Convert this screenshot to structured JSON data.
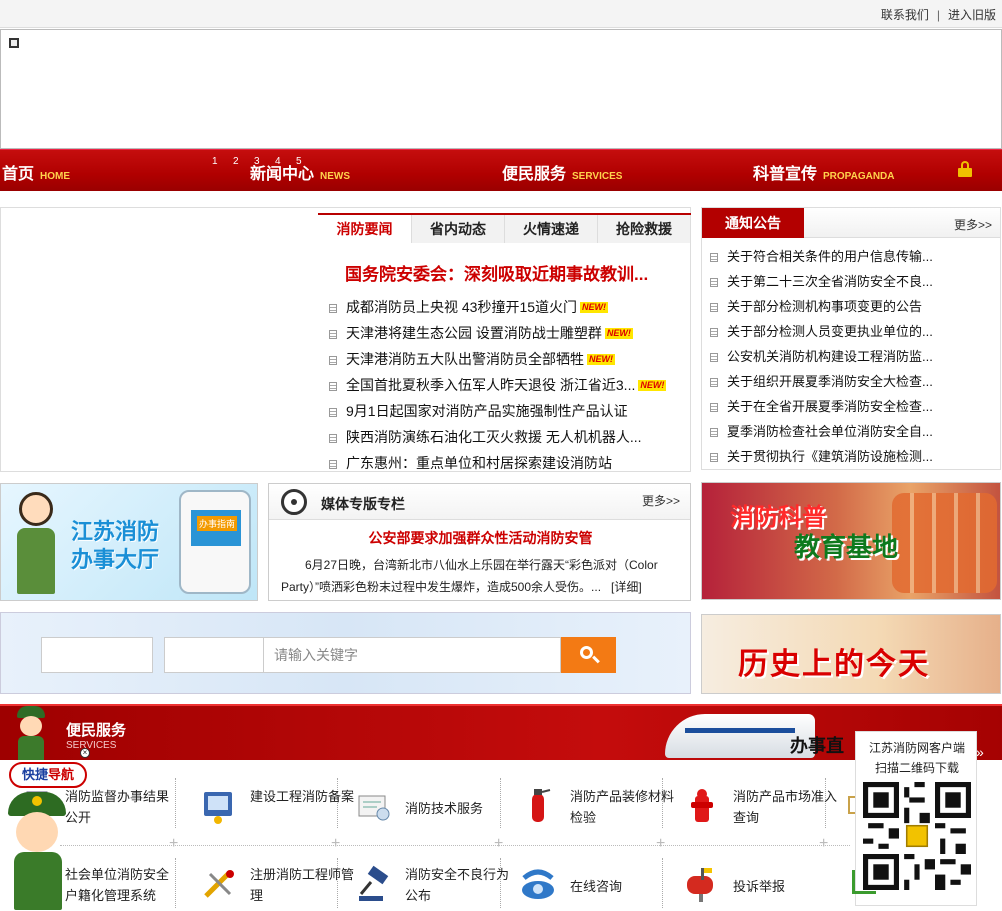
{
  "topbar": {
    "contact": "联系我们",
    "separator": "|",
    "old_version": "进入旧版"
  },
  "nav": {
    "items": [
      {
        "label": "首页",
        "en": "HOME"
      },
      {
        "label": "新闻中心",
        "en": "NEWS"
      },
      {
        "label": "便民服务",
        "en": "SERVICES"
      },
      {
        "label": "科普宣传",
        "en": "PROPAGANDA"
      }
    ],
    "slide_numbers": [
      "1",
      "2",
      "3",
      "4",
      "5"
    ]
  },
  "news": {
    "tabs": [
      "消防要闻",
      "省内动态",
      "火情速递",
      "抢险救援"
    ],
    "headline": "国务院安委会：深刻吸取近期事故教训...",
    "new_tag": "NEW!",
    "items": [
      {
        "text": "成都消防员上央视 43秒撞开15道火门",
        "is_new": true
      },
      {
        "text": "天津港将建生态公园 设置消防战士雕塑群",
        "is_new": true
      },
      {
        "text": "天津港消防五大队出警消防员全部牺牲",
        "is_new": true
      },
      {
        "text": "全国首批夏秋季入伍军人昨天退役 浙江省近3...",
        "is_new": true
      },
      {
        "text": "9月1日起国家对消防产品实施强制性产品认证",
        "is_new": false
      },
      {
        "text": "陕西消防演练石油化工灭火救援 无人机机器人...",
        "is_new": false
      },
      {
        "text": "广东惠州：重点单位和村居探索建设消防站",
        "is_new": false
      }
    ]
  },
  "notice": {
    "title": "通知公告",
    "more": "更多>>",
    "items": [
      "关于符合相关条件的用户信息传输...",
      "关于第二十三次全省消防安全不良...",
      "关于部分检测机构事项变更的公告",
      "关于部分检测人员变更执业单位的...",
      "公安机关消防机构建设工程消防监...",
      "关于组织开展夏季消防安全大检查...",
      "关于在全省开展夏季消防安全检查...",
      "夏季消防检查社会单位消防安全自...",
      "关于贯彻执行《建筑消防设施检测..."
    ]
  },
  "hall": {
    "title_line1": "江苏消防",
    "title_line2": "办事大厅",
    "kiosk_label": "办事指南"
  },
  "media": {
    "title": "媒体专版专栏",
    "more": "更多>>",
    "article_title": "公安部要求加强群众性活动消防安管",
    "article_text": "6月27日晚，台湾新北市八仙水上乐园在举行露天“彩色派对（Color Party）”喷洒彩色粉末过程中发生爆炸，造成500余人受伤。...",
    "detail_link": "[详细]"
  },
  "ads": {
    "science_line1": "消防科普",
    "science_line2": "教育基地",
    "history": "历史上的今天"
  },
  "search": {
    "placeholder": "请输入关键字"
  },
  "services": {
    "title": "便民服务",
    "en": "SERVICES",
    "banner_text": "办事直",
    "arrow": "»",
    "row1": [
      {
        "label": "消防监督办事结果公开",
        "icon": "document-icon"
      },
      {
        "label": "建设工程消防备案",
        "icon": "filing-icon"
      },
      {
        "label": "消防技术服务",
        "icon": "technical-service-icon"
      },
      {
        "label": "消防产品装修材料检验",
        "icon": "extinguisher-icon"
      },
      {
        "label": "消防产品市场准入查询",
        "icon": "hydrant-icon"
      }
    ],
    "row2": [
      {
        "label": "社会单位消防安全户籍化管理系统",
        "icon": "registry-icon"
      },
      {
        "label": "注册消防工程师管理",
        "icon": "engineer-tools-icon"
      },
      {
        "label": "消防安全不良行为公布",
        "icon": "gavel-icon"
      },
      {
        "label": "在线咨询",
        "icon": "phone-icon"
      },
      {
        "label": "投诉举报",
        "icon": "mailbox-icon"
      }
    ]
  },
  "quick_nav": {
    "part1": "快捷",
    "part2": "导航",
    "close": "×"
  },
  "qr": {
    "line1": "江苏消防网客户端",
    "line2": "扫描二维码下载"
  },
  "colors": {
    "brand_red": "#b30000",
    "accent_orange": "#f37a14",
    "headline_red": "#cc0000"
  }
}
